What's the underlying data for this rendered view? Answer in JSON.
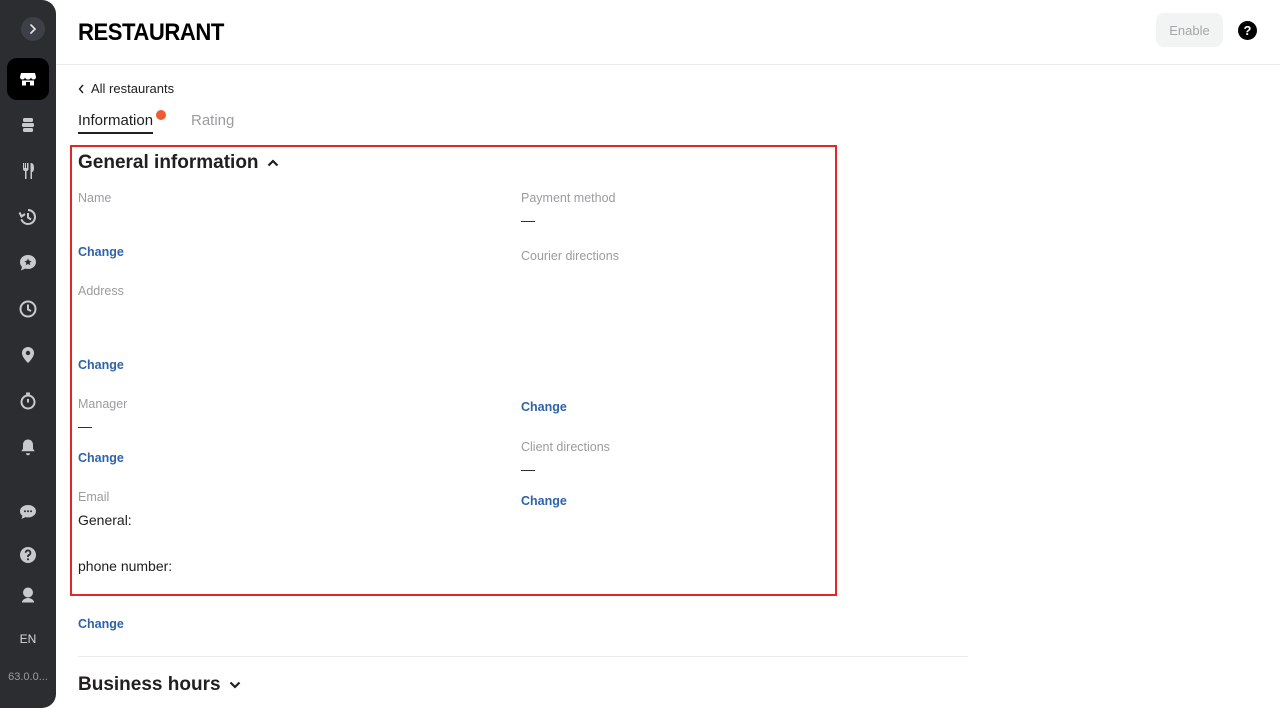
{
  "sidebar": {
    "language": "EN",
    "version": "63.0.0...",
    "icons": [
      "chevron-right-icon",
      "store-icon",
      "layers-icon",
      "fork-knife-icon",
      "history-icon",
      "chat-star-icon",
      "clock-icon",
      "location-pin-icon",
      "stopwatch-icon",
      "bell-icon",
      "chat-icon",
      "help-icon",
      "award-icon"
    ]
  },
  "header": {
    "logo": "RESTAURANT",
    "enable_label": "Enable",
    "help_label": "?"
  },
  "nav": {
    "back_label": "All restaurants"
  },
  "tabs": [
    {
      "label": "Information",
      "active": true,
      "has_dot": true
    },
    {
      "label": "Rating",
      "active": false
    }
  ],
  "colors": {
    "accent_link": "#2e63a8",
    "highlight_border": "#e32626",
    "notification_dot": "#f05a32"
  },
  "general": {
    "title": "General information",
    "left": {
      "name_label": "Name",
      "name_change": "Change",
      "address_label": "Address",
      "address_change": "Change",
      "manager_label": "Manager",
      "manager_value": "—",
      "manager_change": "Change",
      "email_label": "Email",
      "general_label": "General:",
      "phone_label": "phone number:",
      "email_change": "Change"
    },
    "right": {
      "payment_label": "Payment method",
      "payment_value": "—",
      "courier_label": "Courier directions",
      "courier_change": "Change",
      "client_label": "Client directions",
      "client_value": "—",
      "client_change": "Change"
    }
  },
  "business_hours": {
    "title": "Business hours"
  }
}
